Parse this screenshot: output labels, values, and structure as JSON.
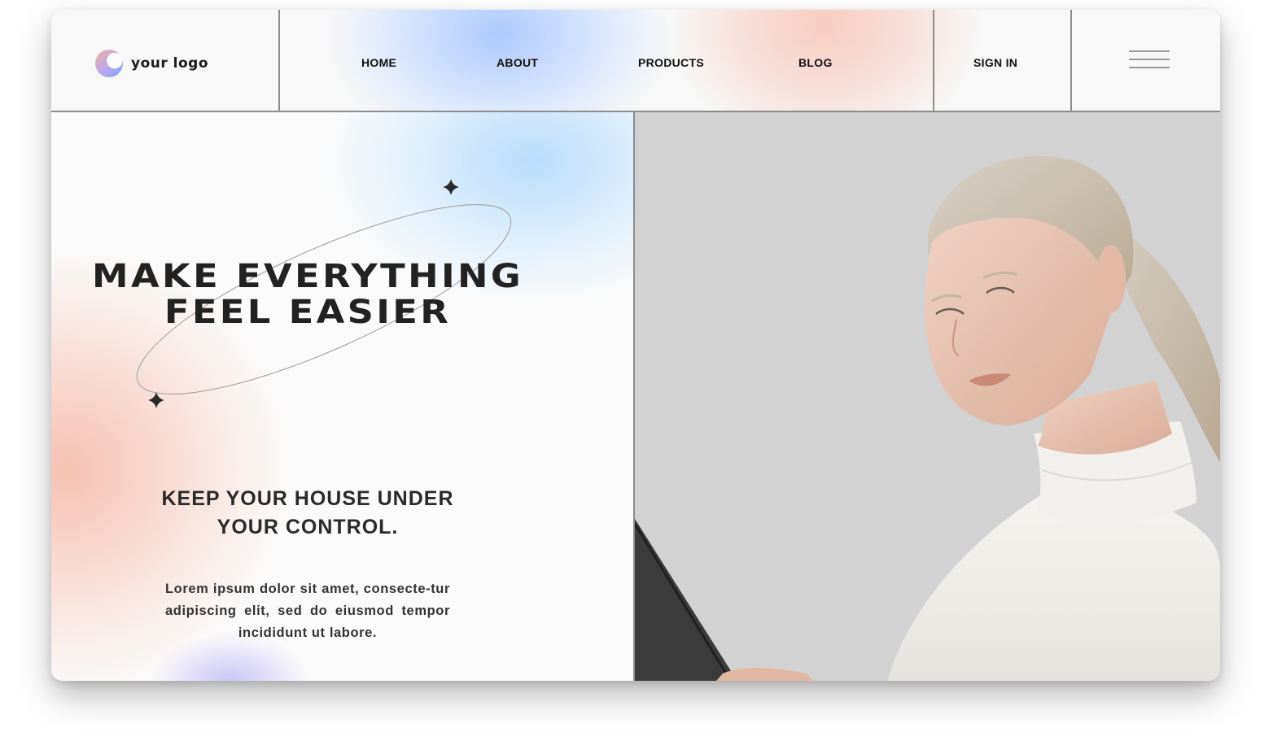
{
  "brand": {
    "logo_text": "your logo"
  },
  "nav": {
    "items": [
      {
        "label": "HOME"
      },
      {
        "label": "ABOUT"
      },
      {
        "label": "PRODUCTS"
      },
      {
        "label": "BLOG"
      }
    ],
    "sign_in": "SIGN IN",
    "menu_icon": "hamburger-menu-icon"
  },
  "hero": {
    "title_line1": "MAKE EVERYTHING",
    "title_line2": "FEEL EASIER",
    "subtitle_line1": "KEEP YOUR HOUSE UNDER",
    "subtitle_line2": "YOUR CONTROL.",
    "body": "Lorem ipsum dolor sit amet, consecte-tur adipiscing elit, sed do eiusmod tempor incididunt ut labore.",
    "decor_icons": [
      "sparkle-star-icon",
      "sparkle-star-icon"
    ],
    "photo": "woman-in-white-turtleneck-photo"
  },
  "colors": {
    "accent_blue": "#aed3f7",
    "accent_peach": "#f3b2a0",
    "text_dark": "#1c1c1c",
    "photo_background": "#d2d2d2",
    "divider": "#8c8c8c"
  }
}
